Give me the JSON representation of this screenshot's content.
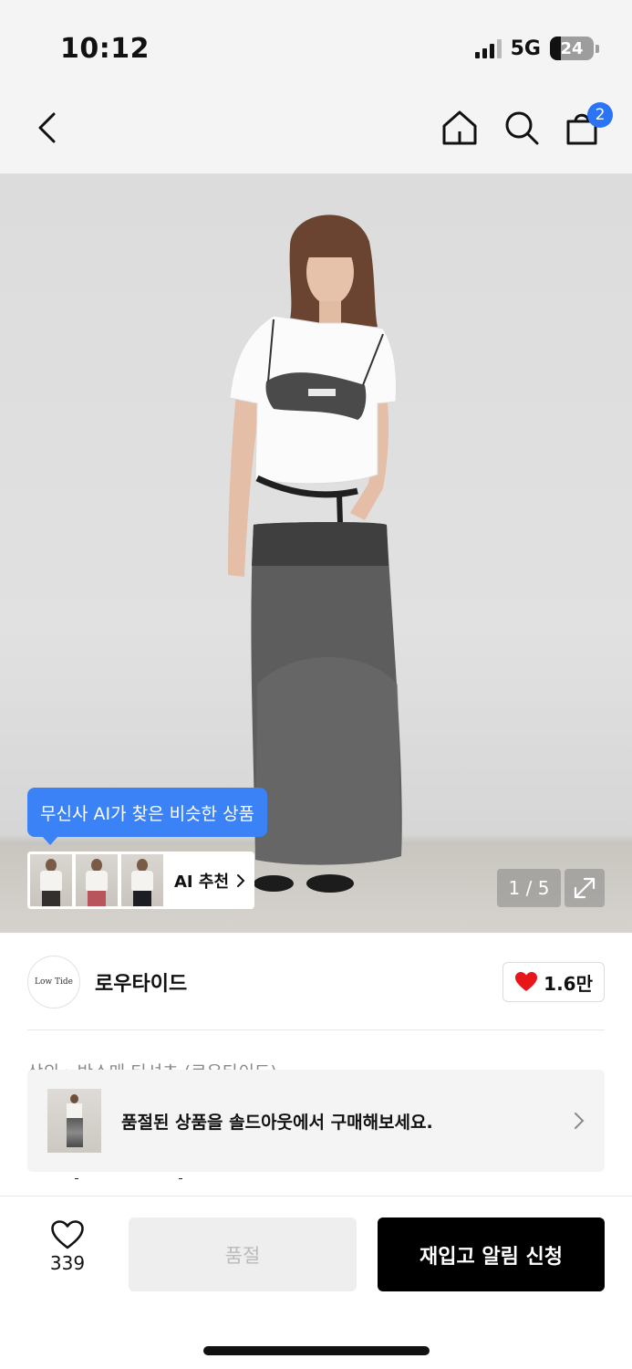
{
  "status_bar": {
    "time": "10:12",
    "network": "5G",
    "battery": "24",
    "battery_level": 0.24
  },
  "header": {
    "cart_count": "2"
  },
  "hero": {
    "ai_bubble": "무신사 AI가 찾은 비슷한 상품",
    "ai_recommend": "AI 추천",
    "page_indicator": "1 / 5"
  },
  "brand": {
    "logo_text": "Low Tide",
    "name": "로우타이드",
    "likes": "1.6만"
  },
  "breadcrumb": "상의 › 반소매 티셔츠 (로우타이드)",
  "soldout_banner": {
    "text": "품절된 상품을 솔드아웃에서 구매해보세요."
  },
  "bottom_bar": {
    "wish_count": "339",
    "soldout_label": "품절",
    "restock_label": "재입고 알림 신청"
  },
  "colors": {
    "accent": "#3b82f6",
    "badge": "#2b74f5",
    "heart": "#e8161b",
    "primary_button": "#000000"
  },
  "icons": [
    "back-icon",
    "home-icon",
    "search-icon",
    "cart-icon",
    "expand-icon",
    "heart-icon",
    "chevron-right-icon"
  ]
}
